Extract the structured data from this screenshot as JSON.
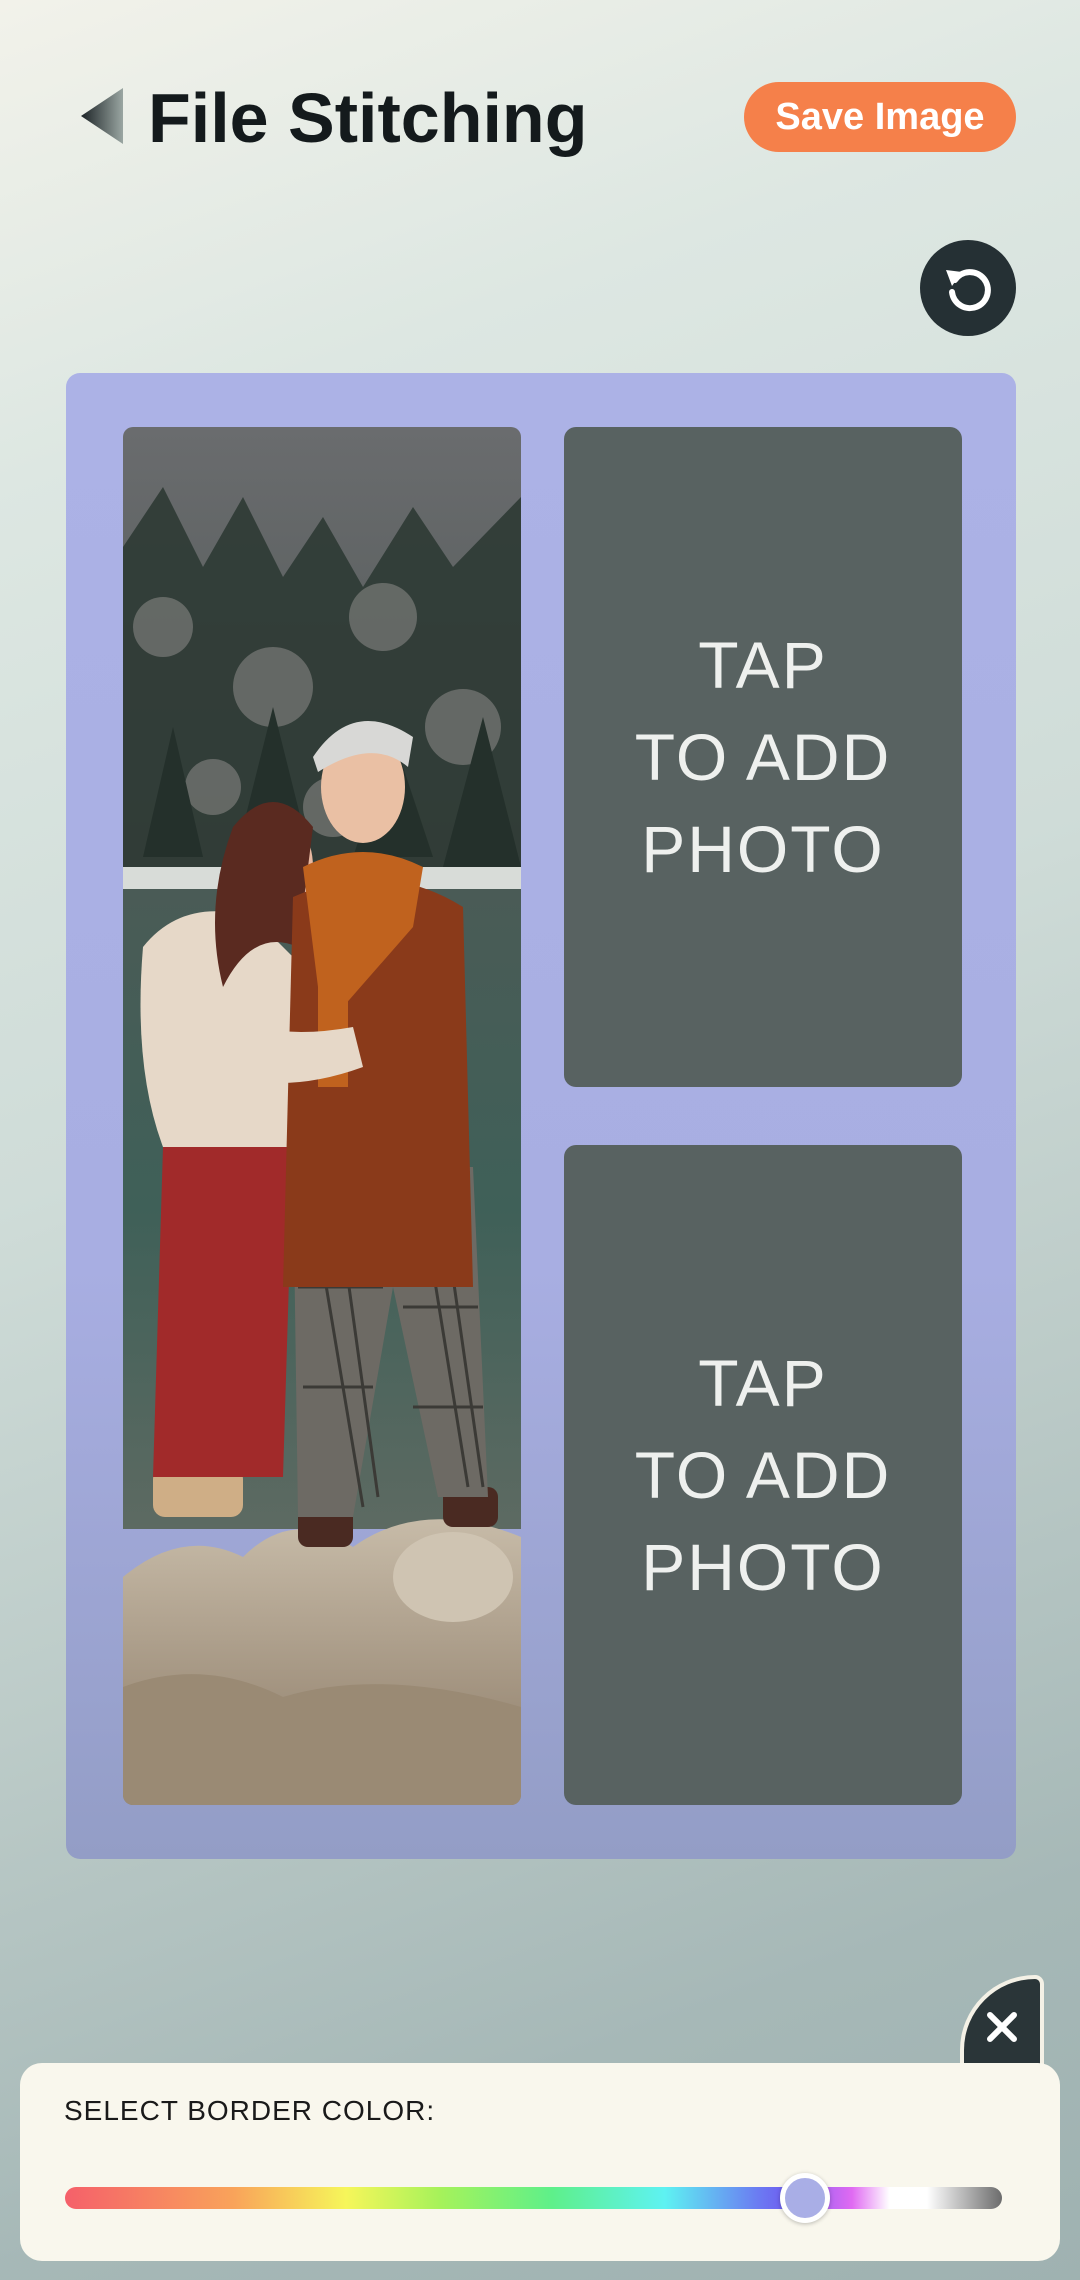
{
  "header": {
    "title": "File Stitching",
    "save_label": "Save Image",
    "back_icon": "back-arrow-icon"
  },
  "toolbar": {
    "reset_icon": "refresh-icon"
  },
  "collage": {
    "border_color": "#acb2e6",
    "slots": [
      {
        "state": "photo"
      },
      {
        "state": "empty",
        "line1": "TAP",
        "line2": "TO ADD",
        "line3": "PHOTO"
      },
      {
        "state": "empty",
        "line1": "TAP",
        "line2": "TO ADD",
        "line3": "PHOTO"
      }
    ]
  },
  "panel": {
    "label": "SELECT BORDER COLOR:",
    "close_icon": "close-icon",
    "slider_value": 0.79
  },
  "colors": {
    "accent": "#f5804a",
    "dark": "#253034",
    "empty_slot": "#586261"
  }
}
